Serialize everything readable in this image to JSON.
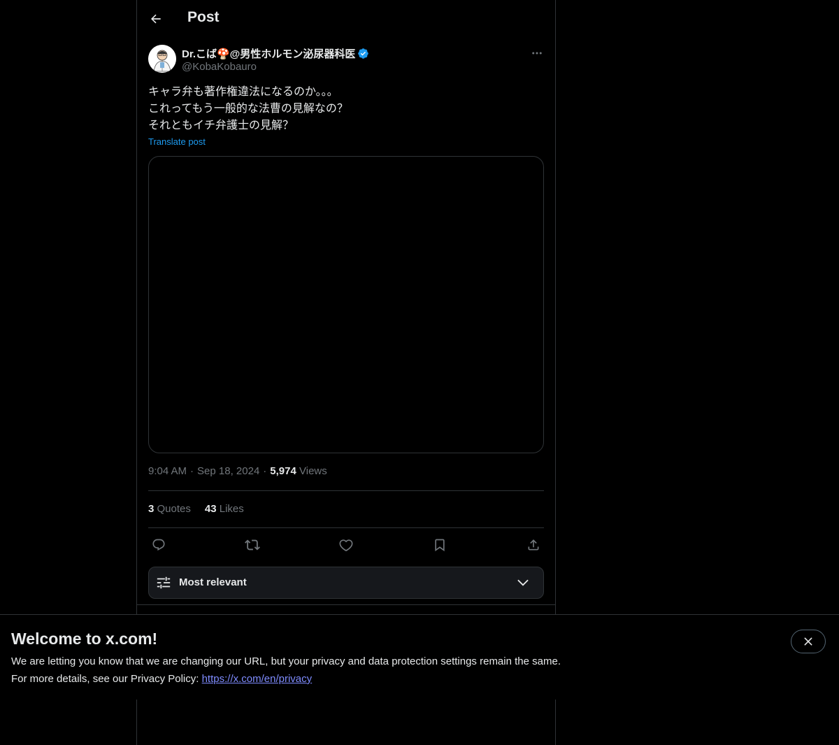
{
  "header": {
    "title": "Post",
    "back_icon": "arrow-left-icon"
  },
  "post": {
    "author": {
      "name": "Dr.こば🍄@男性ホルモン泌尿器科医",
      "handle": "@KobaKobauro",
      "verified": true,
      "verified_color": "#1d9bf0"
    },
    "text_lines": [
      "キャラ弁も著作権違法になるのか。。。",
      "これってもう一般的な法曹の見解なの？",
      "それともイチ弁護士の見解？"
    ],
    "translate_label": "Translate post",
    "time": "9:04 AM",
    "date": "Sep 18, 2024",
    "views_count": "5,974",
    "views_label": "Views",
    "stats": {
      "quotes_count": "3",
      "quotes_label": "Quotes",
      "likes_count": "43",
      "likes_label": "Likes"
    },
    "actions": [
      "reply-icon",
      "repost-icon",
      "like-icon",
      "bookmark-icon",
      "share-icon"
    ]
  },
  "sort": {
    "label": "Most relevant",
    "icon": "sliders-icon",
    "chevron": "chevron-down-icon"
  },
  "banner": {
    "title": "Welcome to x.com!",
    "line1": "We are letting you know that we are changing our URL, but your privacy and data protection settings remain the same.",
    "line2_prefix": "For more details, see our Privacy Policy: ",
    "link_text": "https://x.com/en/privacy",
    "close_icon": "close-icon"
  },
  "colors": {
    "background": "#000000",
    "text": "#e7e9ea",
    "secondary": "#71767b",
    "accent": "#1d9bf0",
    "border": "#2f3336"
  }
}
